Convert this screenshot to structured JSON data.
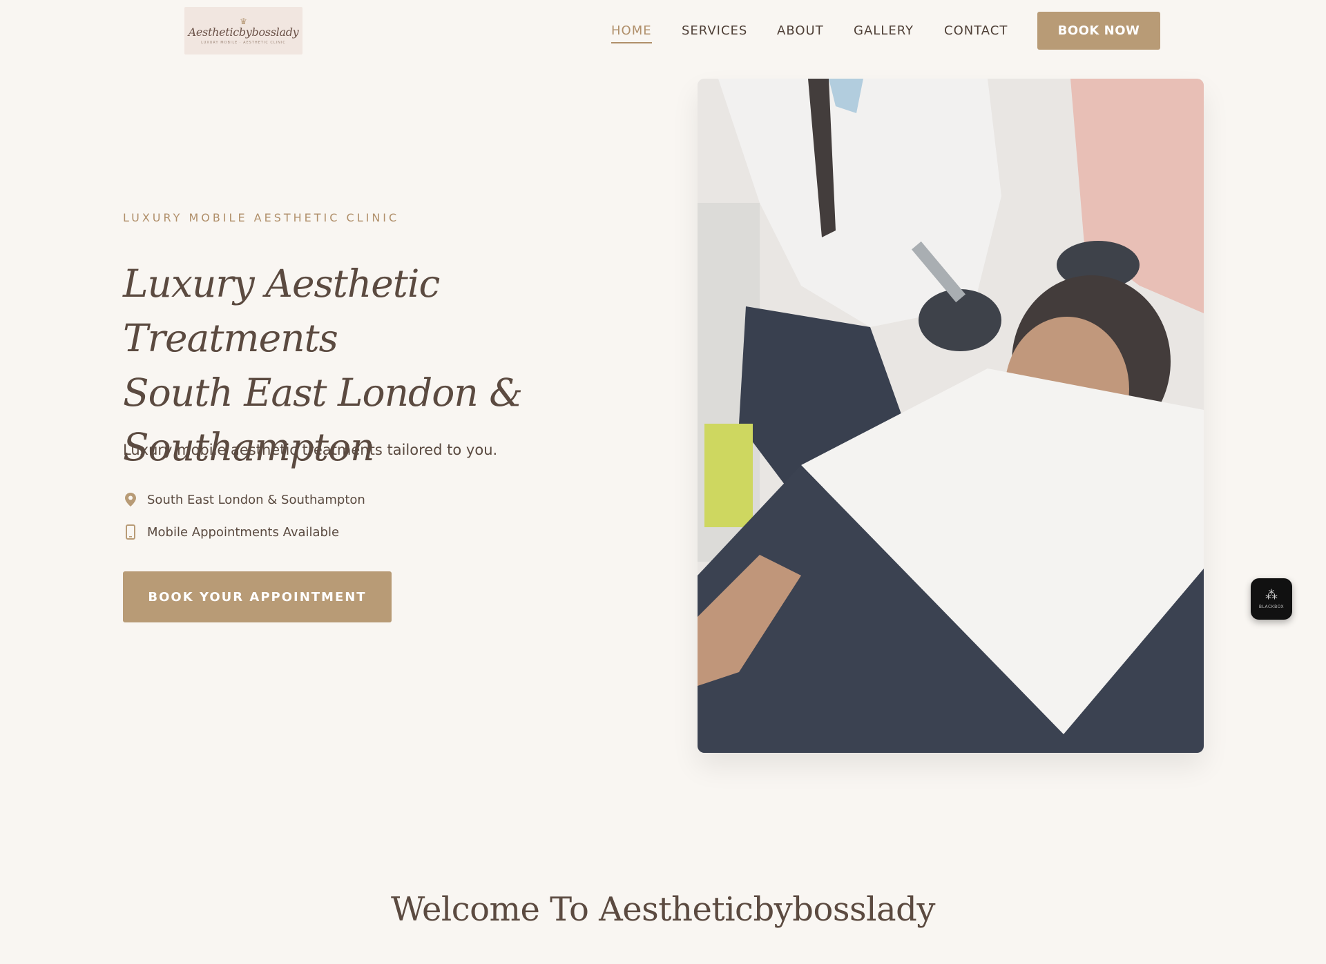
{
  "header": {
    "logo": {
      "script_text": "Aestheticbybosslady",
      "tagline": "LUXURY MOBILE · AESTHETIC CLINIC",
      "icon": "crown-icon"
    },
    "nav": [
      {
        "label": "HOME",
        "active": true
      },
      {
        "label": "SERVICES",
        "active": false
      },
      {
        "label": "ABOUT",
        "active": false
      },
      {
        "label": "GALLERY",
        "active": false
      },
      {
        "label": "CONTACT",
        "active": false
      }
    ],
    "book_now_label": "BOOK NOW"
  },
  "hero": {
    "eyebrow": "LUXURY MOBILE AESTHETIC CLINIC",
    "title_line1": "Luxury Aesthetic Treatments",
    "title_line2": "South East London &",
    "title_line3": "Southampton",
    "subtitle": "Luxury mobile aesthetic treatments tailored to you.",
    "features": [
      {
        "icon": "map-pin-icon",
        "text": "South East London & Southampton"
      },
      {
        "icon": "mobile-phone-icon",
        "text": "Mobile Appointments Available"
      }
    ],
    "cta_label": "BOOK YOUR APPOINTMENT",
    "image": {
      "subject": "treatment-photo"
    }
  },
  "widget": {
    "label": "BLACKBOX",
    "icon": "blackbox-icon"
  },
  "welcome": {
    "title": "Welcome To Aestheticbybosslady"
  },
  "colors": {
    "background": "#f9f6f2",
    "accent": "#b89b76",
    "text": "#5a4a40",
    "active_nav": "#b08f6a"
  }
}
